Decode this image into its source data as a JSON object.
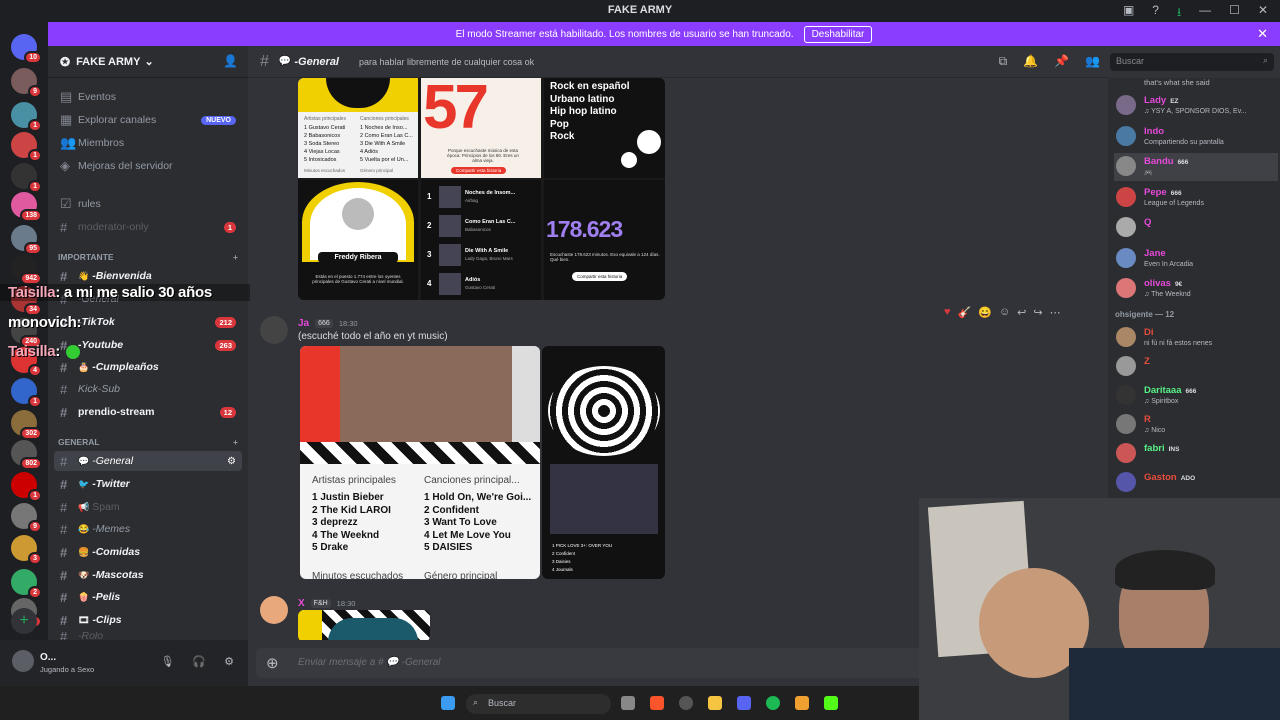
{
  "window": {
    "title": "FAKE ARMY"
  },
  "banner": {
    "text": "El modo Streamer está habilitado. Los nombres de usuario se han truncado.",
    "button": "Deshabilitar"
  },
  "guilds": [
    {
      "badge": "10",
      "color": "#5865f2"
    },
    {
      "badge": "9",
      "color": "#7a5c5c"
    },
    {
      "badge": "1",
      "color": "#4a90a4"
    },
    {
      "badge": "1",
      "color": "#c44"
    },
    {
      "badge": "1",
      "color": "#333"
    },
    {
      "badge": "138",
      "color": "#e05aa0"
    },
    {
      "badge": "95",
      "color": "#6a7b8c"
    },
    {
      "badge": "942",
      "color": "#222"
    },
    {
      "badge": "34",
      "color": "#a33"
    },
    {
      "badge": "240",
      "color": "#444"
    },
    {
      "badge": "4",
      "color": "#d33"
    },
    {
      "badge": "1",
      "color": "#36c"
    },
    {
      "badge": "302",
      "color": "#8a6d3b"
    },
    {
      "badge": "802",
      "color": "#555"
    },
    {
      "badge": "1",
      "color": "#c00"
    },
    {
      "badge": "9",
      "color": "#777"
    },
    {
      "badge": "3",
      "color": "#c93"
    },
    {
      "badge": "2",
      "color": "#3a6"
    },
    {
      "badge": "9",
      "color": "#666"
    }
  ],
  "server": {
    "name": "FAKE ARMY"
  },
  "nav": [
    {
      "label": "Eventos"
    },
    {
      "label": "Explorar canales",
      "badge": "NUEVO"
    },
    {
      "label": "Miembros"
    },
    {
      "label": "Mejoras del servidor"
    }
  ],
  "channels": {
    "rules": "rules",
    "moderator": "moderator-only",
    "moderator_badge": "1",
    "cat_importante": "IMPORTANTE",
    "bienvenida": "-Bienvenida",
    "general_chat": "-General",
    "tiktok": "-TikTok",
    "tiktok_badge": "212",
    "youtube": "-Youtube",
    "youtube_badge": "263",
    "cumpleanos": "-Cumpleaños",
    "kicksub": "Kick-Sub",
    "prendio": "prendio-stream",
    "prendio_badge": "12",
    "cat_general": "GENERAL",
    "general": "-General",
    "twitter": "-Twitter",
    "spam": "Spam",
    "memes": "-Memes",
    "comidas": "-Comidas",
    "mascotas": "-Mascotas",
    "pelis": "-Pelis",
    "clips": "-Clips",
    "rolo": "-Rolo"
  },
  "user": {
    "name": "O...",
    "status": "Jugando a Sexo"
  },
  "header": {
    "channel": "-General",
    "topic": "para hablar libremente de cualquier cosa ok"
  },
  "search": {
    "placeholder": "Buscar"
  },
  "cards1": {
    "c1_h1": "Artistas principales",
    "c1_h2": "Canciones principales",
    "c1_artists": [
      "1 Gustavo Cerati",
      "2 Babasonicos",
      "3 Soda Stereo",
      "4 Viejas Locas",
      "5 Intoxicados"
    ],
    "c1_songs": [
      "1 Noches de Inso...",
      "2 Como Eran Las C...",
      "3 Die With A Smile",
      "4 Adiós",
      "5 Vuelta por el Un..."
    ],
    "c1_min_label": "Minutos escuchados",
    "c1_genre_label": "Género principal",
    "c2_big": "57",
    "c2_text": "Porque escuchaste música de esta época: Principios de los 80. Eres un alma vieja.",
    "c2_btn": "Compartir esta historia",
    "c3_genres": [
      "Rock en español",
      "Urbano latino",
      "Hip hop latino",
      "Pop",
      "Rock"
    ],
    "c4_name": "Freddy Ribera",
    "c4_text": "Estás en el puesto 1.774 entre los oyentes principales de Gustavo Cerati a nivel mundial.",
    "c5_songs": [
      {
        "n": "1",
        "t": "Noches de Insom...",
        "a": "Airbag"
      },
      {
        "n": "2",
        "t": "Como Eran Las C...",
        "a": "Babasonicos"
      },
      {
        "n": "3",
        "t": "Die With A Smile",
        "a": "Lady Gaga, Bruno Mars"
      },
      {
        "n": "4",
        "t": "Adiós",
        "a": "Gustavo Cerati"
      }
    ],
    "c6_big": "178.623",
    "c6_text": "Escuchaste 178.623 minutos. Eso equivale a 124 días. Qué bien.",
    "c6_btn": "Compartir esta historia"
  },
  "msg2": {
    "author": "Ja",
    "tag": "666",
    "time": "18:30",
    "text": "(escuché todo el año en yt music)",
    "artists_h": "Artistas principales",
    "songs_h": "Canciones principal...",
    "artists": [
      "1 Justin Bieber",
      "2 The Kid LAROI",
      "3 deprezz",
      "4 The Weeknd",
      "5 Drake"
    ],
    "songs": [
      "1 Hold On, We're Goi...",
      "2 Confident",
      "3 Want To Love",
      "4 Let Me Love You",
      "5 DAISIES"
    ],
    "min_label": "Minutos escuchados",
    "genre_label": "Género principal",
    "side_items": [
      "1 PICK LOVE 3+: OVER YOU",
      "2 Confident",
      "3 Daisies",
      "4 Journals"
    ],
    "side_sub": [
      "The Kid LAROI",
      "Justin Bieber",
      "Justin Bieber",
      "Justin Bieber"
    ]
  },
  "msg3": {
    "author": "X",
    "tag": "F&H",
    "time": "18:30"
  },
  "composer": {
    "placeholder": "Enviar mensaje a #",
    "channel": "-General"
  },
  "members": {
    "top_text": "that's what she said",
    "list": [
      {
        "name": "Lady",
        "tag": "EZ",
        "act": "♫ YSY A, SPONSOR DIOS, Ev...",
        "color": "#e64ad9"
      },
      {
        "name": "Indo",
        "tag": "",
        "act": "Compartiendo su pantalla",
        "color": "#e64ad9"
      },
      {
        "name": "Bandu",
        "tag": "666",
        "act": "🎮",
        "color": "#e64ad9"
      },
      {
        "name": "Pepe",
        "tag": "666",
        "act": "League of Legends",
        "color": "#e64ad9"
      },
      {
        "name": "Q",
        "tag": "",
        "act": "",
        "color": "#e64ad9"
      },
      {
        "name": "Jane",
        "tag": "",
        "act": "Even In Arcadia",
        "color": "#e64ad9"
      },
      {
        "name": "olivas",
        "tag": "9€",
        "act": "♫ The Weeknd",
        "color": "#e64ad9"
      }
    ],
    "cat2": "ohsigente — 12",
    "list2": [
      {
        "name": "Di",
        "tag": "",
        "act": "ni fú ni fá estos nenes",
        "color": "#e74c3c"
      },
      {
        "name": "Z",
        "tag": "",
        "act": "",
        "color": "#e74c3c"
      },
      {
        "name": "Daritaaa",
        "tag": "666",
        "act": "♫ Spiritbox",
        "color": "#57f287"
      },
      {
        "name": "R",
        "tag": "",
        "act": "♫ Nico",
        "color": "#e74c3c"
      },
      {
        "name": "fabri",
        "tag": "INS",
        "act": "",
        "color": "#57f287"
      },
      {
        "name": "Gaston",
        "tag": "ADO",
        "act": "",
        "color": "#e74c3c"
      }
    ]
  },
  "overlay": [
    {
      "who": "Taisilla",
      "text": ": a mi me salio 30 años"
    },
    {
      "who": "monovich",
      "text": ":"
    },
    {
      "who": "Taisilla",
      "text": ":"
    }
  ],
  "taskbar": {
    "search": "Buscar"
  }
}
